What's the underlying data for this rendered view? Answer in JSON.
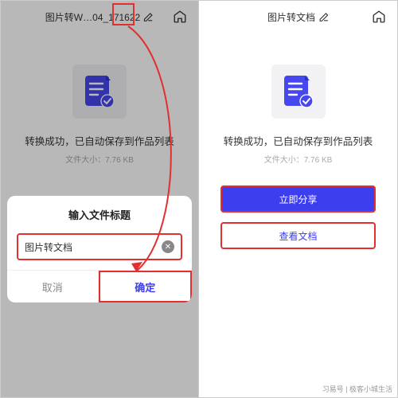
{
  "left": {
    "header_title": "图片转W…04_171622",
    "success": "转换成功，已自动保存到作品列表",
    "filesize": "文件大小：7.76 KB",
    "dialog": {
      "title": "输入文件标题",
      "input_value": "图片转文档",
      "cancel": "取消",
      "confirm": "确定"
    }
  },
  "right": {
    "header_title": "图片转文档",
    "success": "转换成功，已自动保存到作品列表",
    "filesize": "文件大小：7.76 KB",
    "share_btn": "立即分享",
    "view_btn": "查看文档"
  },
  "watermark": "习易号 | 极客小城生活"
}
